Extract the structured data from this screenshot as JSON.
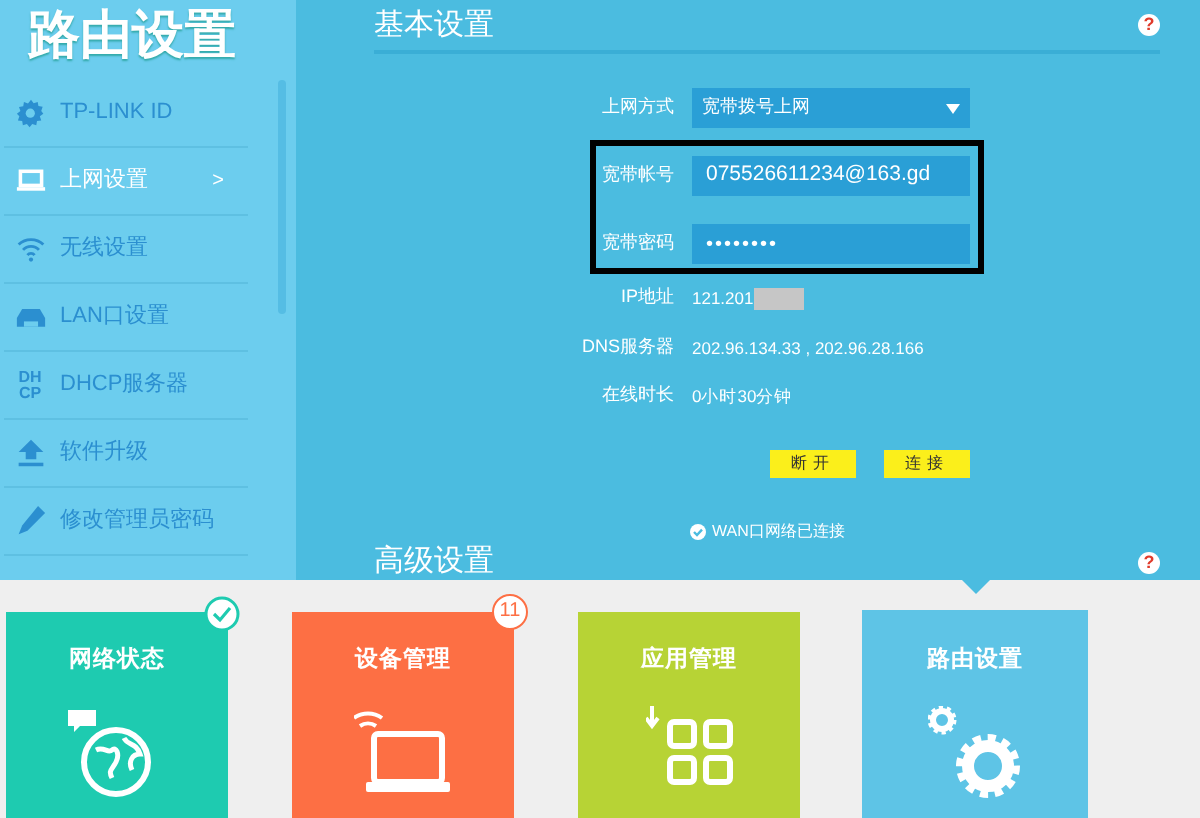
{
  "sidebar": {
    "title": "路由设置",
    "items": [
      {
        "label": "TP-LINK ID",
        "selected": false
      },
      {
        "label": "上网设置",
        "selected": true,
        "arrow": ">"
      },
      {
        "label": "无线设置",
        "selected": false
      },
      {
        "label": "LAN口设置",
        "selected": false
      },
      {
        "label": "DHCP服务器",
        "selected": false,
        "icon_label": "DHCP"
      },
      {
        "label": "软件升级",
        "selected": false
      },
      {
        "label": "修改管理员密码",
        "selected": false
      }
    ]
  },
  "basic": {
    "title": "基本设置",
    "help": "?",
    "connection_type": {
      "label": "上网方式",
      "value": "宽带拨号上网"
    },
    "account": {
      "label": "宽带帐号",
      "value": "075526611234@163.gd"
    },
    "password": {
      "label": "宽带密码",
      "value": "••••••••"
    },
    "info": [
      {
        "label": "IP地址",
        "value": "121.201",
        "redacted": true
      },
      {
        "label": "DNS服务器",
        "value": "202.96.134.33 , 202.96.28.166",
        "redacted": false
      },
      {
        "label": "在线时长",
        "value": "0小时30分钟",
        "redacted": false
      }
    ],
    "buttons": [
      "断开",
      "连接"
    ],
    "status": "WAN口网络已连接"
  },
  "advanced": {
    "title": "高级设置",
    "help": "?"
  },
  "tiles": [
    {
      "label": "网络状态",
      "color": "#1ecbb0",
      "selected": false,
      "badge": {
        "kind": "check"
      }
    },
    {
      "label": "设备管理",
      "color": "#fd6f44",
      "selected": false,
      "badge": {
        "kind": "count",
        "text": "11"
      }
    },
    {
      "label": "应用管理",
      "color": "#b7d335",
      "selected": false
    },
    {
      "label": "路由设置",
      "color": "#5ec4e6",
      "selected": true
    }
  ]
}
